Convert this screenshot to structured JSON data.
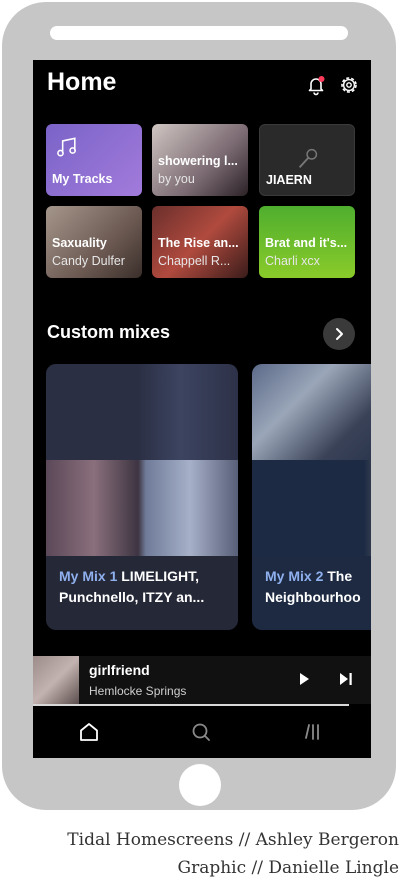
{
  "header": {
    "title": "Home"
  },
  "tiles": [
    {
      "line1": "My Tracks",
      "line2": ""
    },
    {
      "line1": "showering l...",
      "line2": "by you"
    },
    {
      "line1": "JIAERN",
      "line2": ""
    },
    {
      "line1": "Saxuality",
      "line2": "Candy Dulfer"
    },
    {
      "line1": "The Rise an...",
      "line2": "Chappell R..."
    },
    {
      "line1": "Brat and it's...",
      "line2": "Charli xcx"
    }
  ],
  "custom_mixes": {
    "title": "Custom mixes",
    "items": [
      {
        "accent": "My Mix 1",
        "text": "LIMELIGHT, Punchnello, ITZY an..."
      },
      {
        "accent": "My Mix 2",
        "text": "The Neighbourhoo"
      }
    ]
  },
  "now_playing": {
    "track": "girlfriend",
    "artist": "Hemlocke Springs"
  },
  "icons": {
    "bell": "bell-icon",
    "gear": "gear-icon",
    "note": "music-note-icon",
    "mic": "microphone-icon",
    "chevron": "chevron-right-icon",
    "play": "play-icon",
    "next": "skip-next-icon",
    "home": "home-icon",
    "search": "search-icon",
    "library": "library-icon"
  },
  "colors": {
    "accent_blue": "#8fb0ee",
    "my_tracks_purple": "#8f6fd4",
    "notification_dot": "#ff3b5c"
  },
  "credits": {
    "line1": "Tidal Homescreens // Ashley Bergeron",
    "line2": "Graphic // Danielle Lingle"
  }
}
